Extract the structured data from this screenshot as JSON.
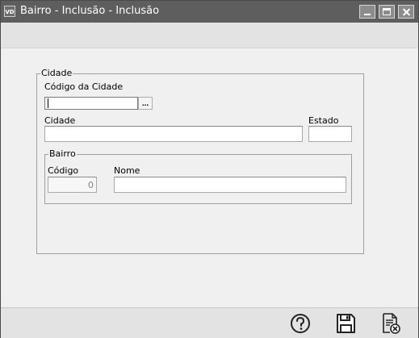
{
  "window": {
    "icon_text": "VD",
    "title": "Bairro - Inclusão - Inclusão"
  },
  "cidade_group": {
    "title": "Cidade",
    "codigo_label": "Código da Cidade",
    "codigo_value": "",
    "lookup_label": "...",
    "cidade_label": "Cidade",
    "cidade_value": "",
    "estado_label": "Estado",
    "estado_value": ""
  },
  "bairro_group": {
    "title": "Bairro",
    "codigo_label": "Código",
    "codigo_value": "0",
    "nome_label": "Nome",
    "nome_value": ""
  },
  "footer": {
    "buttons": [
      {
        "icon": "help-icon"
      },
      {
        "icon": "save-icon"
      },
      {
        "icon": "cancel-document-icon"
      }
    ]
  }
}
